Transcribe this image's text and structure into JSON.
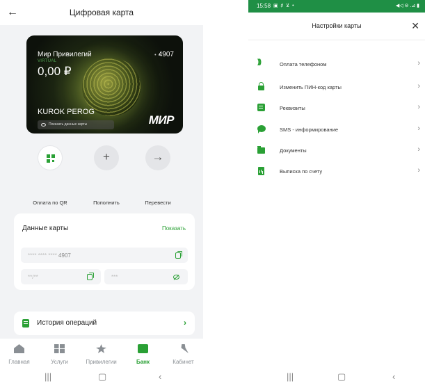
{
  "left": {
    "header": {
      "title": "Цифровая карта",
      "back_icon": "arrow-left-icon"
    },
    "card": {
      "name": "Мир Привилегий",
      "type": "VIRTUAL",
      "masked": "• •",
      "last4": "4907",
      "balance": "0,00 ₽",
      "holder": "KUROK PEROG",
      "show_data": "Показать данные карты",
      "brand": "МИР"
    },
    "actions": [
      {
        "label": "Оплата по QR",
        "icon": "qr-icon",
        "symbol": ""
      },
      {
        "label": "Пополнить",
        "icon": "plus-icon",
        "symbol": "+"
      },
      {
        "label": "Перевести",
        "icon": "arrow-right-icon",
        "symbol": "→"
      }
    ],
    "card_details": {
      "title": "Данные карты",
      "show_link": "Показать",
      "number_mask": "**** **** ****",
      "number_last4": "4907",
      "expiry_mask": "**/**",
      "cvv_mask": "***"
    },
    "history": {
      "label": "История операций"
    },
    "tabs": [
      {
        "label": "Главная",
        "icon": "home-icon",
        "active": false
      },
      {
        "label": "Услуги",
        "icon": "grid-icon",
        "active": false
      },
      {
        "label": "Привилегии",
        "icon": "star-icon",
        "active": false
      },
      {
        "label": "Банк",
        "icon": "wallet-icon",
        "active": true
      },
      {
        "label": "Кабинет",
        "icon": "user-icon",
        "active": false
      }
    ],
    "system_nav": {
      "recents": "|||",
      "home": "▢",
      "back": "‹"
    }
  },
  "right": {
    "status_bar": {
      "time": "15:58",
      "left_icons": "▣ ♯ ⊻ •",
      "right_icons": "◀◁ ⊜ .⊿ ▮"
    },
    "header": {
      "title": "Настройки карты",
      "close_icon": "close-icon"
    },
    "menu": [
      {
        "label": "Оплата телефоном",
        "icon": "nfc-icon"
      },
      {
        "label": "Изменить ПИН-код карты",
        "icon": "lock-icon"
      },
      {
        "label": "Реквизиты",
        "icon": "document-icon"
      },
      {
        "label": "SMS - информирование",
        "icon": "chat-icon"
      },
      {
        "label": "Документы",
        "icon": "folder-icon"
      },
      {
        "label": "Выписка по счету",
        "icon": "statement-icon"
      }
    ],
    "system_nav": {
      "recents": "|||",
      "home": "▢",
      "back": "‹"
    }
  },
  "colors": {
    "accent": "#2aa035",
    "status_bar": "#1f8f45",
    "background": "#f2f3f5"
  }
}
